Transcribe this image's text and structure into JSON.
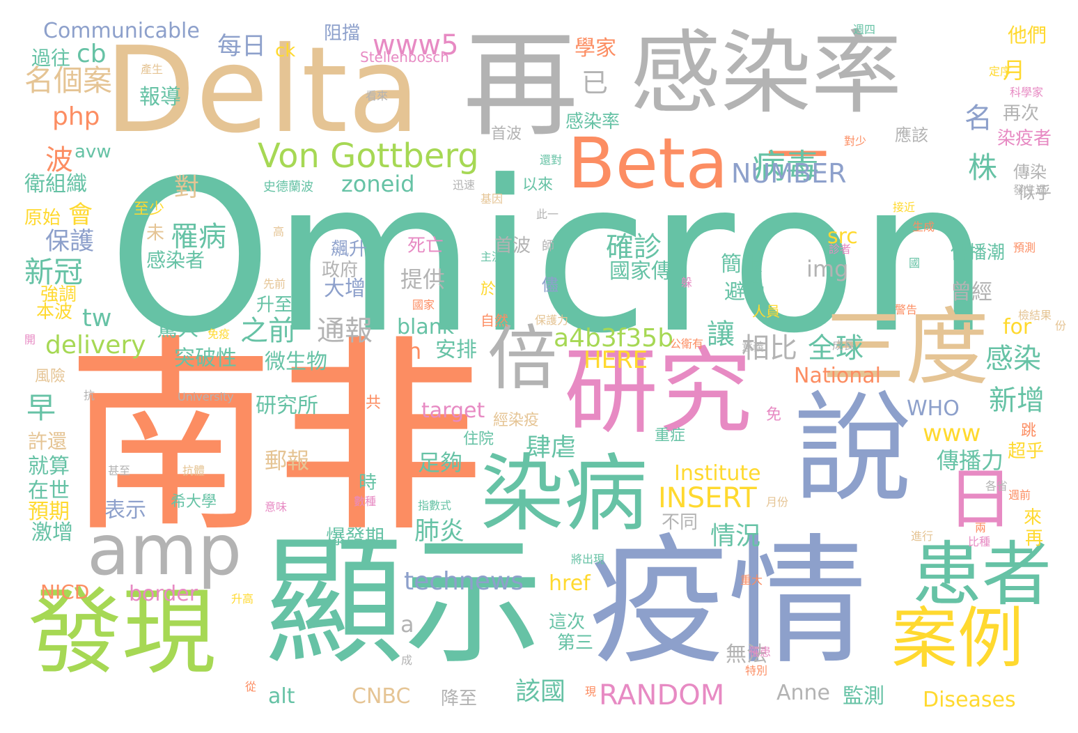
{
  "palette": {
    "green": "#66c2a5",
    "orange": "#fc8d62",
    "blue": "#8da0cb",
    "pink": "#e78ac3",
    "lime": "#a6d854",
    "yellow": "#ffd92f",
    "tan": "#e5c494",
    "gray": "#b3b3b3"
  },
  "words": [
    {
      "text": "Omicron"
    },
    {
      "text": "南非"
    },
    {
      "text": "顯示"
    },
    {
      "text": "疫情"
    },
    {
      "text": "Delta"
    },
    {
      "text": "再"
    },
    {
      "text": "感染率"
    },
    {
      "text": "一"
    },
    {
      "text": "說"
    },
    {
      "text": "研究"
    },
    {
      "text": "發現"
    },
    {
      "text": "染病"
    },
    {
      "text": "Beta"
    },
    {
      "text": "amp"
    },
    {
      "text": "三度"
    },
    {
      "text": "倍"
    },
    {
      "text": "患者"
    },
    {
      "text": "案例"
    },
    {
      "text": "日"
    },
    {
      "text": "Von Gottberg"
    },
    {
      "text": "病毒"
    },
    {
      "text": "株"
    },
    {
      "text": "Communicable"
    },
    {
      "text": "每日"
    },
    {
      "text": "ck"
    },
    {
      "text": "www5"
    },
    {
      "text": "學家"
    },
    {
      "text": "他們"
    },
    {
      "text": "名個案"
    },
    {
      "text": "cb"
    },
    {
      "text": "php"
    },
    {
      "text": "已"
    },
    {
      "text": "月"
    },
    {
      "text": "名"
    },
    {
      "text": "NUMBER"
    },
    {
      "text": "zoneid"
    },
    {
      "text": "波"
    },
    {
      "text": "衛組織"
    },
    {
      "text": "會"
    },
    {
      "text": "對"
    },
    {
      "text": "罹病"
    },
    {
      "text": "確診"
    },
    {
      "text": "感染者"
    },
    {
      "text": "新冠"
    },
    {
      "text": "保護"
    },
    {
      "text": "delivery"
    },
    {
      "text": "tw"
    },
    {
      "text": "a4b3f35b"
    },
    {
      "text": "之前"
    },
    {
      "text": "通報"
    },
    {
      "text": "相比"
    },
    {
      "text": "讓"
    },
    {
      "text": "全球"
    },
    {
      "text": "感染"
    },
    {
      "text": "新增"
    },
    {
      "text": "HERE"
    },
    {
      "text": "National"
    },
    {
      "text": "WHO"
    },
    {
      "text": "target"
    },
    {
      "text": "研究所"
    },
    {
      "text": "微生物"
    },
    {
      "text": "突破性"
    },
    {
      "text": "早"
    },
    {
      "text": "www"
    },
    {
      "text": "肆虐"
    },
    {
      "text": "傳播力"
    },
    {
      "text": "INSERT"
    },
    {
      "text": "Institute"
    },
    {
      "text": "technews"
    },
    {
      "text": "情況"
    },
    {
      "text": "肺炎"
    },
    {
      "text": "href"
    },
    {
      "text": "border"
    },
    {
      "text": "NICD"
    },
    {
      "text": "RANDOM"
    },
    {
      "text": "CNBC"
    },
    {
      "text": "alt"
    },
    {
      "text": "Anne"
    },
    {
      "text": "Diseases"
    },
    {
      "text": "監測"
    },
    {
      "text": "該國"
    },
    {
      "text": "無法"
    },
    {
      "text": "img"
    },
    {
      "text": "src"
    },
    {
      "text": "blank"
    },
    {
      "text": "提供"
    },
    {
      "text": "大增"
    },
    {
      "text": "for"
    },
    {
      "text": "avw"
    },
    {
      "text": "Stellenbosch"
    },
    {
      "text": "University"
    },
    {
      "text": "n"
    },
    {
      "text": "a"
    },
    {
      "text": "安排"
    },
    {
      "text": "足夠"
    },
    {
      "text": "郵報"
    },
    {
      "text": "表示"
    },
    {
      "text": "希大學"
    },
    {
      "text": "爆發期"
    },
    {
      "text": "激增"
    },
    {
      "text": "預期"
    },
    {
      "text": "在世"
    },
    {
      "text": "就算"
    },
    {
      "text": "許還"
    },
    {
      "text": "驚人"
    },
    {
      "text": "升至"
    },
    {
      "text": "本波"
    },
    {
      "text": "強調"
    },
    {
      "text": "國家傳"
    },
    {
      "text": "簡報"
    },
    {
      "text": "避免"
    },
    {
      "text": "曾經"
    },
    {
      "text": "傳播潮"
    },
    {
      "text": "再次"
    },
    {
      "text": "染疫者"
    },
    {
      "text": "傳染"
    },
    {
      "text": "似乎"
    },
    {
      "text": "應該"
    },
    {
      "text": "首波"
    },
    {
      "text": "感染率"
    },
    {
      "text": "史德蘭波"
    },
    {
      "text": "以來"
    },
    {
      "text": "報導"
    },
    {
      "text": "過往"
    },
    {
      "text": "原始"
    },
    {
      "text": "至少"
    },
    {
      "text": "未"
    },
    {
      "text": "飆升"
    },
    {
      "text": "政府"
    },
    {
      "text": "死亡"
    },
    {
      "text": "這次"
    },
    {
      "text": "第三"
    },
    {
      "text": "降至"
    },
    {
      "text": "超乎"
    },
    {
      "text": "來"
    },
    {
      "text": "再"
    },
    {
      "text": "住院"
    },
    {
      "text": "經染疫"
    },
    {
      "text": "不同"
    },
    {
      "text": "時"
    },
    {
      "text": "重症"
    },
    {
      "text": "阻擋"
    },
    {
      "text": "首波"
    },
    {
      "text": "人員"
    },
    {
      "text": "高"
    },
    {
      "text": "主流"
    },
    {
      "text": "師"
    },
    {
      "text": "儘"
    },
    {
      "text": "於"
    },
    {
      "text": "國家"
    },
    {
      "text": "保護力"
    },
    {
      "text": "自然"
    },
    {
      "text": "先前"
    },
    {
      "text": "免疫"
    },
    {
      "text": "共"
    },
    {
      "text": "風險"
    },
    {
      "text": "抗"
    },
    {
      "text": "跳"
    },
    {
      "text": "免"
    },
    {
      "text": "預測"
    },
    {
      "text": "警告"
    },
    {
      "text": "檢結果"
    },
    {
      "text": "公衛有"
    },
    {
      "text": "意義"
    },
    {
      "text": "成長"
    },
    {
      "text": "抗體"
    },
    {
      "text": "甚至"
    },
    {
      "text": "指數式"
    },
    {
      "text": "意味"
    },
    {
      "text": "數種"
    },
    {
      "text": "月份"
    },
    {
      "text": "兩"
    },
    {
      "text": "週前"
    },
    {
      "text": "各省"
    },
    {
      "text": "進行"
    },
    {
      "text": "比種"
    },
    {
      "text": "將出現"
    },
    {
      "text": "重大"
    },
    {
      "text": "升高"
    },
    {
      "text": "罹患"
    },
    {
      "text": "特別"
    },
    {
      "text": "現"
    },
    {
      "text": "從"
    },
    {
      "text": "成"
    },
    {
      "text": "週四"
    },
    {
      "text": "產生"
    },
    {
      "text": "定序"
    },
    {
      "text": "科學家"
    },
    {
      "text": "看來"
    },
    {
      "text": "還對"
    },
    {
      "text": "迅速"
    },
    {
      "text": "基因"
    },
    {
      "text": "此一"
    },
    {
      "text": "發生過"
    },
    {
      "text": "接近"
    },
    {
      "text": "生成"
    },
    {
      "text": "診者"
    },
    {
      "text": "國"
    },
    {
      "text": "開"
    },
    {
      "text": "份"
    },
    {
      "text": "躲"
    },
    {
      "text": "對少"
    }
  ]
}
